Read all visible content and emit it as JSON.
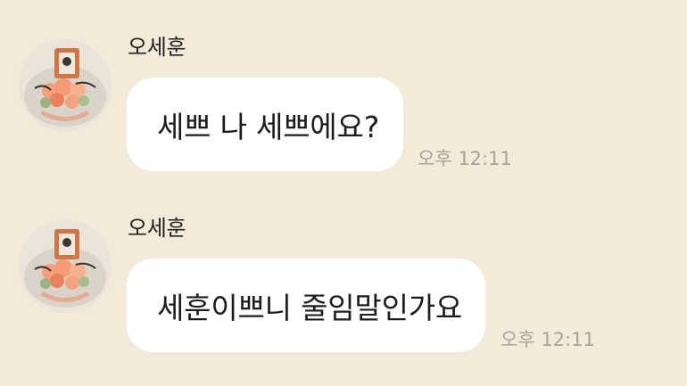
{
  "conversation": {
    "messages": [
      {
        "sender": "오세훈",
        "text": "세쁘 나 세쁘에요?",
        "time": "오후 12:11",
        "avatar_icon": "profile-photo-flower-bouquet"
      },
      {
        "sender": "오세훈",
        "text": "세훈이쁘니 줄임말인가요",
        "time": "오후 12:11",
        "avatar_icon": "profile-photo-flower-bouquet"
      }
    ]
  },
  "colors": {
    "background": "#f3ead9",
    "bubble": "#ffffff",
    "timestamp": "#a8a39b",
    "text": "#1c1c1c"
  }
}
